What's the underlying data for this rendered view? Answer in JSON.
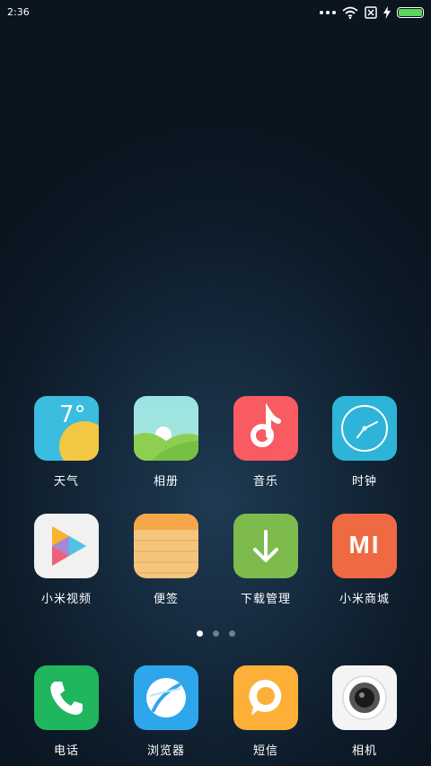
{
  "status_bar": {
    "time": "2:36",
    "icons": [
      "more-dots-icon",
      "wifi-icon",
      "no-sim-icon",
      "charging-icon",
      "battery-icon"
    ],
    "battery_level": 1.0
  },
  "home": {
    "rows": [
      [
        {
          "name": "weather",
          "label": "天气",
          "icon_text": "7°"
        },
        {
          "name": "gallery",
          "label": "相册"
        },
        {
          "name": "music",
          "label": "音乐"
        },
        {
          "name": "clock",
          "label": "时钟"
        }
      ],
      [
        {
          "name": "mi-video",
          "label": "小米视频"
        },
        {
          "name": "notes",
          "label": "便签"
        },
        {
          "name": "downloads",
          "label": "下载管理"
        },
        {
          "name": "mi-store",
          "label": "小米商城",
          "icon_text": "MI"
        }
      ]
    ],
    "pages": 3,
    "current_page": 1
  },
  "dock": [
    {
      "name": "phone",
      "label": "电话"
    },
    {
      "name": "browser",
      "label": "浏览器"
    },
    {
      "name": "messages",
      "label": "短信"
    },
    {
      "name": "camera",
      "label": "相机"
    }
  ],
  "colors": {
    "weather": "#3bbde0",
    "gallery": "#8dd9a0",
    "music": "#f85b61",
    "clock": "#2eb4d8",
    "mi-video": "#f1f1f1",
    "notes": "#f6c57d",
    "downloads": "#7dbb4c",
    "mi-store": "#ef6a43",
    "phone": "#1fb65d",
    "browser": "#2ea6ec",
    "messages": "#fdb037",
    "camera": "#f4f4f4",
    "battery": "#5bd55a"
  }
}
